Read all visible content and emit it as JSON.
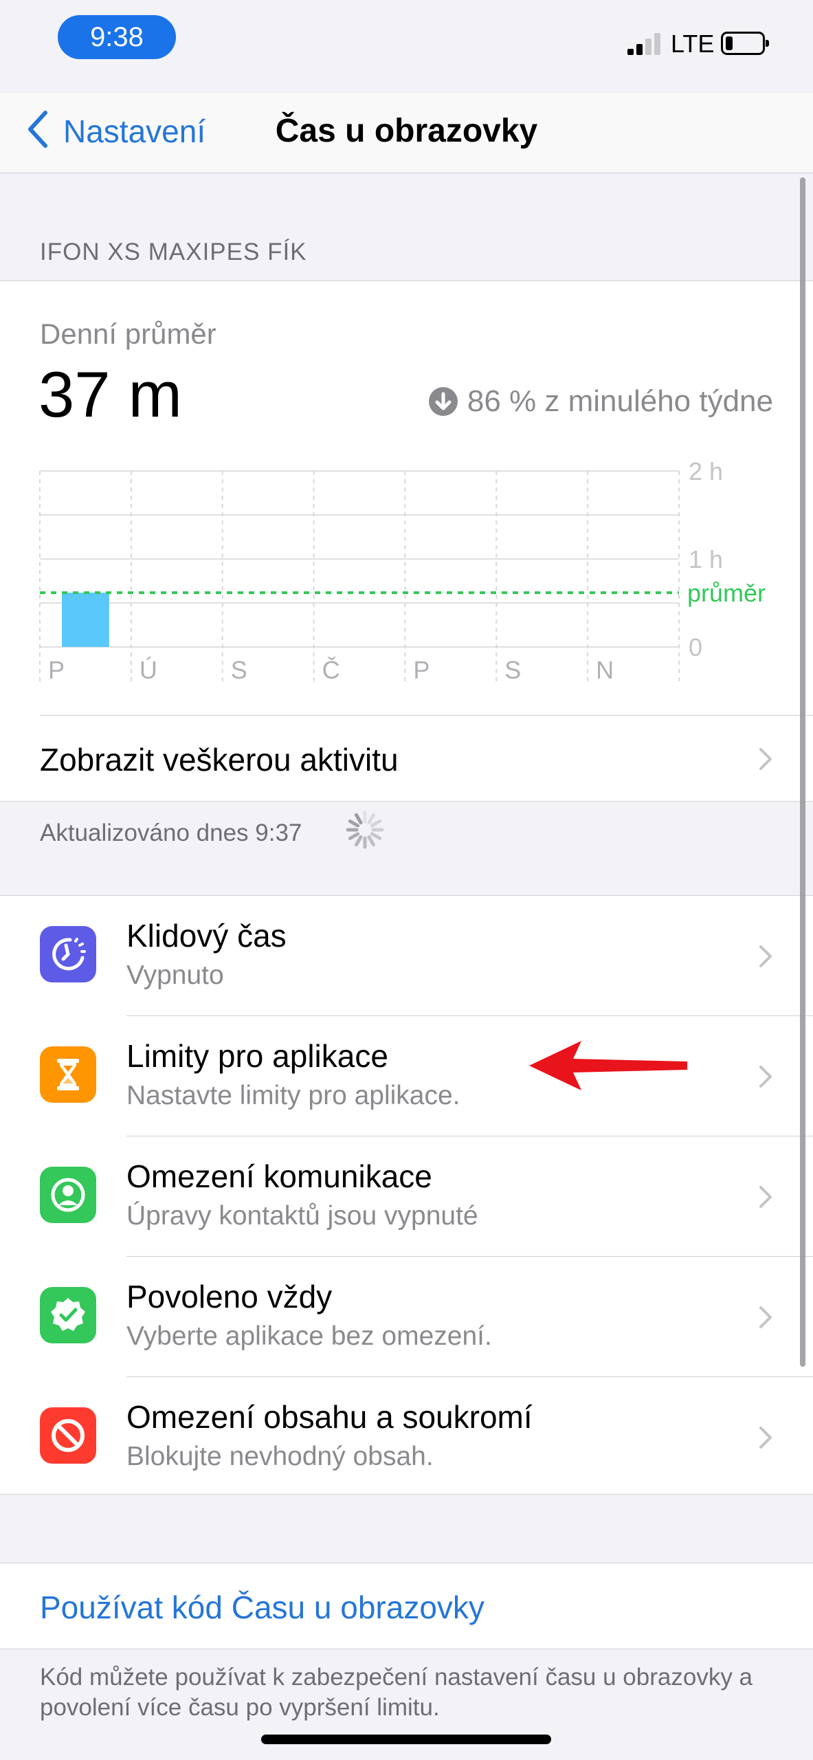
{
  "status_bar": {
    "time": "9:38",
    "network": "LTE"
  },
  "nav": {
    "back_label": "Nastavení",
    "title": "Čas u obrazovky"
  },
  "device_section": {
    "header": "IFON XS MAXIPES FÍK"
  },
  "summary": {
    "label": "Denní průměr",
    "value": "37 m",
    "trend_text": "86 % z minulého týdne"
  },
  "chart_data": {
    "type": "bar",
    "categories": [
      "P",
      "Ú",
      "S",
      "Č",
      "P",
      "S",
      "N"
    ],
    "values": [
      37,
      0,
      0,
      0,
      0,
      0,
      0
    ],
    "value_unit": "minutes",
    "y_ticks": [
      "2 h",
      "1 h",
      "0"
    ],
    "ylim": [
      0,
      120
    ],
    "average": 37,
    "average_label": "průměr",
    "bar_color": "#5ac8fa",
    "average_color": "#34c759",
    "grid": true
  },
  "activity": {
    "label": "Zobrazit veškerou aktivitu"
  },
  "updated": {
    "text": "Aktualizováno dnes 9:37"
  },
  "menu": {
    "items": [
      {
        "title": "Klidový čas",
        "subtitle": "Vypnuto",
        "icon": "downtime-icon",
        "color": "#5e5ce6"
      },
      {
        "title": "Limity pro aplikace",
        "subtitle": "Nastavte limity pro aplikace.",
        "icon": "hourglass-icon",
        "color": "#ff9500"
      },
      {
        "title": "Omezení komunikace",
        "subtitle": "Úpravy kontaktů jsou vypnuté",
        "icon": "contact-icon",
        "color": "#34c759"
      },
      {
        "title": "Povoleno vždy",
        "subtitle": "Vyberte aplikace bez omezení.",
        "icon": "checkmark-badge-icon",
        "color": "#34c759"
      },
      {
        "title": "Omezení obsahu a soukromí",
        "subtitle": "Blokujte nevhodný obsah.",
        "icon": "restriction-icon",
        "color": "#ff3b30"
      }
    ]
  },
  "passcode": {
    "label": "Používat kód Času u obrazovky",
    "footer": "Kód můžete používat k zabezpečení nastavení času u obrazovky a povolení více času po vypršení limitu."
  },
  "annotation": {
    "arrow_color": "#e8131b"
  }
}
